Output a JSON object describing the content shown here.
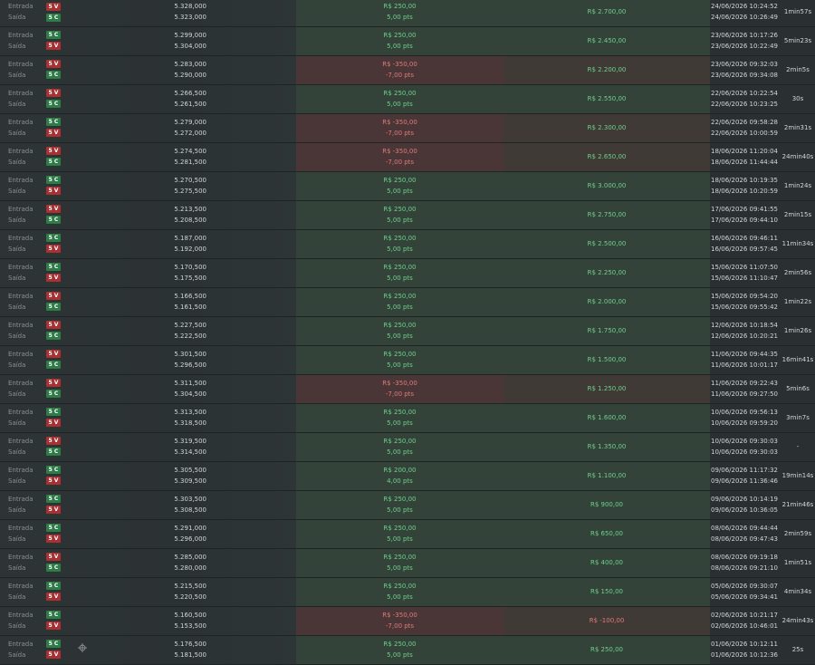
{
  "labels": {
    "entry": "Entrada",
    "exit": "Saída"
  },
  "rows": [
    {
      "s1": "5 V",
      "s2": "5 C",
      "p1": "5.328,000",
      "p2": "5.323,000",
      "r1": "R$ 250,00",
      "r2": "5,00 pts",
      "bal": "R$ 2.700,00",
      "d1": "24/06/2026 10:24:52",
      "d2": "24/06/2026 10:26:49",
      "dur": "1min57s",
      "type": "pos"
    },
    {
      "s1": "5 C",
      "s2": "5 V",
      "p1": "5.299,000",
      "p2": "5.304,000",
      "r1": "R$ 250,00",
      "r2": "5,00 pts",
      "bal": "R$ 2.450,00",
      "d1": "23/06/2026 10:17:26",
      "d2": "23/06/2026 10:22:49",
      "dur": "5min23s",
      "type": "pos"
    },
    {
      "s1": "5 V",
      "s2": "5 C",
      "p1": "5.283,000",
      "p2": "5.290,000",
      "r1": "R$ -350,00",
      "r2": "-7,00 pts",
      "bal": "R$ 2.200,00",
      "d1": "23/06/2026 09:32:03",
      "d2": "23/06/2026 09:34:08",
      "dur": "2min5s",
      "type": "neg"
    },
    {
      "s1": "5 V",
      "s2": "5 C",
      "p1": "5.266,500",
      "p2": "5.261,500",
      "r1": "R$ 250,00",
      "r2": "5,00 pts",
      "bal": "R$ 2.550,00",
      "d1": "22/06/2026 10:22:54",
      "d2": "22/06/2026 10:23:25",
      "dur": "30s",
      "type": "pos"
    },
    {
      "s1": "5 C",
      "s2": "5 V",
      "p1": "5.279,000",
      "p2": "5.272,000",
      "r1": "R$ -350,00",
      "r2": "-7,00 pts",
      "bal": "R$ 2.300,00",
      "d1": "22/06/2026 09:58:28",
      "d2": "22/06/2026 10:00:59",
      "dur": "2min31s",
      "type": "neg"
    },
    {
      "s1": "5 V",
      "s2": "5 C",
      "p1": "5.274,500",
      "p2": "5.281,500",
      "r1": "R$ -350,00",
      "r2": "-7,00 pts",
      "bal": "R$ 2.650,00",
      "d1": "18/06/2026 11:20:04",
      "d2": "18/06/2026 11:44:44",
      "dur": "24min40s",
      "type": "neg"
    },
    {
      "s1": "5 C",
      "s2": "5 V",
      "p1": "5.270,500",
      "p2": "5.275,500",
      "r1": "R$ 250,00",
      "r2": "5,00 pts",
      "bal": "R$ 3.000,00",
      "d1": "18/06/2026 10:19:35",
      "d2": "18/06/2026 10:20:59",
      "dur": "1min24s",
      "type": "pos"
    },
    {
      "s1": "5 V",
      "s2": "5 C",
      "p1": "5.213,500",
      "p2": "5.208,500",
      "r1": "R$ 250,00",
      "r2": "5,00 pts",
      "bal": "R$ 2.750,00",
      "d1": "17/06/2026 09:41:55",
      "d2": "17/06/2026 09:44:10",
      "dur": "2min15s",
      "type": "pos"
    },
    {
      "s1": "5 C",
      "s2": "5 V",
      "p1": "5.187,000",
      "p2": "5.192,000",
      "r1": "R$ 250,00",
      "r2": "5,00 pts",
      "bal": "R$ 2.500,00",
      "d1": "16/06/2026 09:46:11",
      "d2": "16/06/2026 09:57:45",
      "dur": "11min34s",
      "type": "pos"
    },
    {
      "s1": "5 C",
      "s2": "5 V",
      "p1": "5.170,500",
      "p2": "5.175,500",
      "r1": "R$ 250,00",
      "r2": "5,00 pts",
      "bal": "R$ 2.250,00",
      "d1": "15/06/2026 11:07:50",
      "d2": "15/06/2026 11:10:47",
      "dur": "2min56s",
      "type": "pos"
    },
    {
      "s1": "5 V",
      "s2": "5 C",
      "p1": "5.166,500",
      "p2": "5.161,500",
      "r1": "R$ 250,00",
      "r2": "5,00 pts",
      "bal": "R$ 2.000,00",
      "d1": "15/06/2026 09:54:20",
      "d2": "15/06/2026 09:55:42",
      "dur": "1min22s",
      "type": "pos"
    },
    {
      "s1": "5 V",
      "s2": "5 C",
      "p1": "5.227,500",
      "p2": "5.222,500",
      "r1": "R$ 250,00",
      "r2": "5,00 pts",
      "bal": "R$ 1.750,00",
      "d1": "12/06/2026 10:18:54",
      "d2": "12/06/2026 10:20:21",
      "dur": "1min26s",
      "type": "pos"
    },
    {
      "s1": "5 V",
      "s2": "5 C",
      "p1": "5.301,500",
      "p2": "5.296,500",
      "r1": "R$ 250,00",
      "r2": "5,00 pts",
      "bal": "R$ 1.500,00",
      "d1": "11/06/2026 09:44:35",
      "d2": "11/06/2026 10:01:17",
      "dur": "16min41s",
      "type": "pos"
    },
    {
      "s1": "5 V",
      "s2": "5 C",
      "p1": "5.311,500",
      "p2": "5.304,500",
      "r1": "R$ -350,00",
      "r2": "-7,00 pts",
      "bal": "R$ 1.250,00",
      "d1": "11/06/2026 09:22:43",
      "d2": "11/06/2026 09:27:50",
      "dur": "5min6s",
      "type": "neg"
    },
    {
      "s1": "5 C",
      "s2": "5 V",
      "p1": "5.313,500",
      "p2": "5.318,500",
      "r1": "R$ 250,00",
      "r2": "5,00 pts",
      "bal": "R$ 1.600,00",
      "d1": "10/06/2026 09:56:13",
      "d2": "10/06/2026 09:59:20",
      "dur": "3min7s",
      "type": "pos"
    },
    {
      "s1": "5 V",
      "s2": "5 C",
      "p1": "5.319,500",
      "p2": "5.314,500",
      "r1": "R$ 250,00",
      "r2": "5,00 pts",
      "bal": "R$ 1.350,00",
      "d1": "10/06/2026 09:30:03",
      "d2": "10/06/2026 09:30:03",
      "dur": "-",
      "type": "pos"
    },
    {
      "s1": "5 C",
      "s2": "5 V",
      "p1": "5.305,500",
      "p2": "5.309,500",
      "r1": "R$ 200,00",
      "r2": "4,00 pts",
      "bal": "R$ 1.100,00",
      "d1": "09/06/2026 11:17:32",
      "d2": "09/06/2026 11:36:46",
      "dur": "19min14s",
      "type": "pos"
    },
    {
      "s1": "5 C",
      "s2": "5 V",
      "p1": "5.303,500",
      "p2": "5.308,500",
      "r1": "R$ 250,00",
      "r2": "5,00 pts",
      "bal": "R$ 900,00",
      "d1": "09/06/2026 10:14:19",
      "d2": "09/06/2026 10:36:05",
      "dur": "21min46s",
      "type": "pos"
    },
    {
      "s1": "5 C",
      "s2": "5 V",
      "p1": "5.291,000",
      "p2": "5.296,000",
      "r1": "R$ 250,00",
      "r2": "5,00 pts",
      "bal": "R$ 650,00",
      "d1": "08/06/2026 09:44:44",
      "d2": "08/06/2026 09:47:43",
      "dur": "2min59s",
      "type": "pos"
    },
    {
      "s1": "5 V",
      "s2": "5 C",
      "p1": "5.285,000",
      "p2": "5.280,000",
      "r1": "R$ 250,00",
      "r2": "5,00 pts",
      "bal": "R$ 400,00",
      "d1": "08/06/2026 09:19:18",
      "d2": "08/06/2026 09:21:10",
      "dur": "1min51s",
      "type": "pos"
    },
    {
      "s1": "5 C",
      "s2": "5 V",
      "p1": "5.215,500",
      "p2": "5.220,500",
      "r1": "R$ 250,00",
      "r2": "5,00 pts",
      "bal": "R$ 150,00",
      "d1": "05/06/2026 09:30:07",
      "d2": "05/06/2026 09:34:41",
      "dur": "4min34s",
      "type": "pos"
    },
    {
      "s1": "5 C",
      "s2": "5 V",
      "p1": "5.160,500",
      "p2": "5.153,500",
      "r1": "R$ -350,00",
      "r2": "-7,00 pts",
      "bal": "R$ -100,00",
      "d1": "02/06/2026 10:21:17",
      "d2": "02/06/2026 10:46:01",
      "dur": "24min43s",
      "type": "neg"
    },
    {
      "s1": "5 C",
      "s2": "5 V",
      "p1": "5.176,500",
      "p2": "5.181,500",
      "r1": "R$ 250,00",
      "r2": "5,00 pts",
      "bal": "R$ 250,00",
      "d1": "01/06/2026 10:12:11",
      "d2": "01/06/2026 10:12:36",
      "dur": "25s",
      "type": "pos"
    }
  ]
}
